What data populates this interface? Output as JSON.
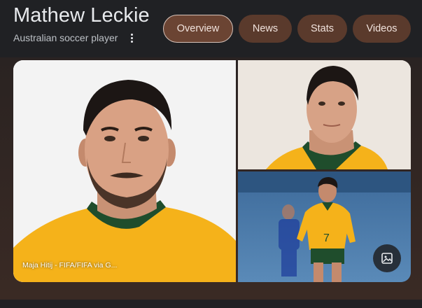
{
  "header": {
    "title": "Mathew Leckie",
    "subtitle": "Australian soccer player",
    "more_icon": "more-vert-icon"
  },
  "tabs": [
    {
      "label": "Overview",
      "active": true
    },
    {
      "label": "News",
      "active": false
    },
    {
      "label": "Stats",
      "active": false
    },
    {
      "label": "Videos",
      "active": false
    }
  ],
  "images": {
    "credit": "Maja Hitij - FIFA/FIFA via G...",
    "image_search_icon": "image-search-icon"
  },
  "colors": {
    "background": "#202124",
    "tab_background": "#5a3a2c",
    "active_tab_border": "#d7c3ba",
    "jersey_yellow": "#f5b21a",
    "collar_green": "#1f4d2c"
  }
}
